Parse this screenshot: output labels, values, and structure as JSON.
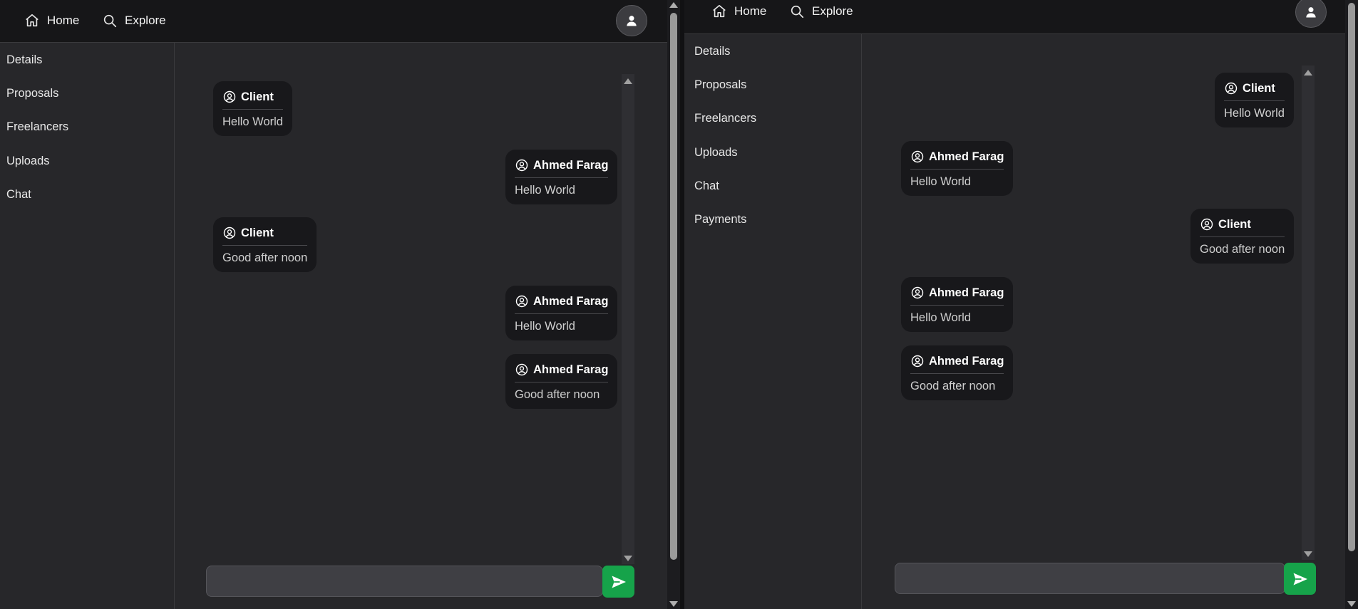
{
  "colors": {
    "background": "#27272a",
    "topbar": "#161618",
    "bubble": "#18181b",
    "accent_send": "#16a34a"
  },
  "left_window": {
    "nav": {
      "home_label": "Home",
      "explore_label": "Explore"
    },
    "sidebar": {
      "items": [
        "Details",
        "Proposals",
        "Freelancers",
        "Uploads",
        "Chat"
      ]
    },
    "messages": [
      {
        "sender": "Client",
        "text": "Hello World",
        "align": "left"
      },
      {
        "sender": "Ahmed Farag",
        "text": "Hello World",
        "align": "right"
      },
      {
        "sender": "Client",
        "text": "Good after noon",
        "align": "left"
      },
      {
        "sender": "Ahmed Farag",
        "text": "Hello World",
        "align": "right"
      },
      {
        "sender": "Ahmed Farag",
        "text": "Good after noon",
        "align": "right"
      }
    ],
    "input": {
      "value": "",
      "placeholder": ""
    }
  },
  "right_window": {
    "nav": {
      "home_label": "Home",
      "explore_label": "Explore"
    },
    "sidebar": {
      "items": [
        "Details",
        "Proposals",
        "Freelancers",
        "Uploads",
        "Chat",
        "Payments"
      ]
    },
    "messages": [
      {
        "sender": "Client",
        "text": "Hello World",
        "align": "right"
      },
      {
        "sender": "Ahmed Farag",
        "text": "Hello World",
        "align": "left"
      },
      {
        "sender": "Client",
        "text": "Good after noon",
        "align": "right"
      },
      {
        "sender": "Ahmed Farag",
        "text": "Hello World",
        "align": "left"
      },
      {
        "sender": "Ahmed Farag",
        "text": "Good after noon",
        "align": "left"
      }
    ],
    "input": {
      "value": "",
      "placeholder": ""
    }
  },
  "icons": [
    "home-icon",
    "search-icon",
    "user-icon",
    "user-circle-icon",
    "send-icon"
  ]
}
